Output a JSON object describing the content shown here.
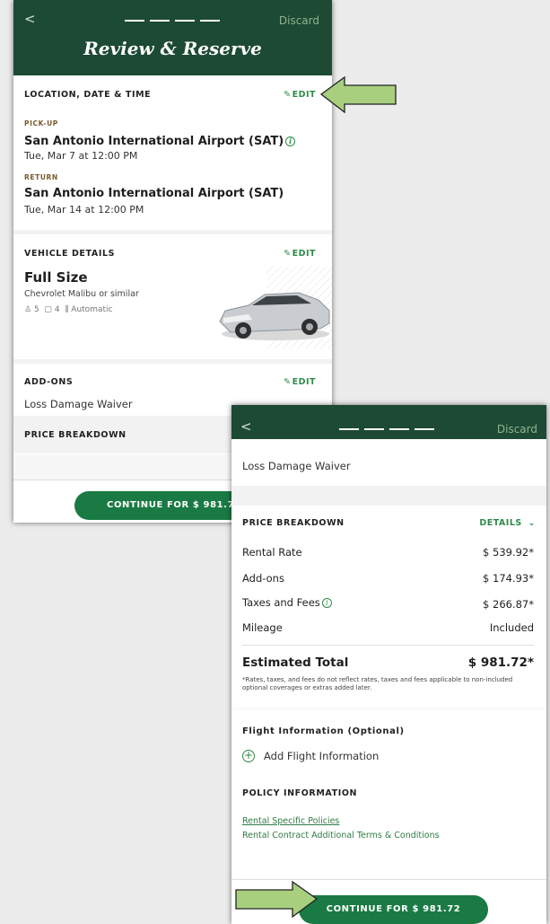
{
  "header": {
    "back_glyph": "<",
    "discard_label": "Discard",
    "title": "Review & Reserve"
  },
  "location": {
    "section_label": "LOCATION, DATE & TIME",
    "edit_label": "EDIT",
    "pickup_label": "PICK-UP",
    "pickup_location": "San Antonio International Airport (SAT)",
    "pickup_datetime": "Tue, Mar 7  at  12:00 PM",
    "return_label": "RETURN",
    "return_location": "San Antonio International Airport (SAT)",
    "return_datetime": "Tue, Mar 14  at  12:00 PM"
  },
  "vehicle": {
    "section_label": "VEHICLE DETAILS",
    "edit_label": "EDIT",
    "class": "Full Size",
    "model": "Chevrolet Malibu or similar",
    "passengers": "5",
    "bags": "4",
    "transmission": "Automatic"
  },
  "addons": {
    "section_label": "ADD-ONS",
    "edit_label": "EDIT",
    "items": [
      "Loss Damage Waiver"
    ]
  },
  "price": {
    "section_label": "PRICE BREAKDOWN",
    "details_label": "DETAILS",
    "rows": [
      {
        "label": "Rental Rate",
        "value": "$ 539.92*"
      },
      {
        "label": "Add-ons",
        "value": "$ 174.93*"
      },
      {
        "label": "Taxes and Fees",
        "value": "$ 266.87*"
      },
      {
        "label": "Mileage",
        "value": "Included"
      }
    ],
    "total_label": "Estimated Total",
    "total_value": "$ 981.72*",
    "disclaimer": "*Rates, taxes, and fees do not reflect rates, taxes and fees applicable to non-included optional coverages or extras added later."
  },
  "flight": {
    "section_label": "Flight Information (Optional)",
    "add_label": "Add Flight Information"
  },
  "policy": {
    "section_label": "POLICY INFORMATION",
    "link1": "Rental Specific Policies",
    "link2": "Rental Contract Additional Terms & Conditions"
  },
  "cta": {
    "label": "CONTINUE FOR $ 981.72",
    "label_truncated": "CONTINUE FOR $ 981.7"
  },
  "colors": {
    "header_green": "#1d4a34",
    "accent_green": "#2f8a4a",
    "button_green": "#1a7a43",
    "arrow_fill": "#a8cf7e"
  },
  "icons": {
    "back": "chevron-left-icon",
    "edit": "pencil-icon",
    "info": "info-icon",
    "passengers": "person-icon",
    "bags": "bag-icon",
    "transmission": "gear-shift-icon",
    "details": "chevron-down-icon",
    "add": "plus-circle-icon",
    "callout": "arrow-pointer-icon"
  }
}
